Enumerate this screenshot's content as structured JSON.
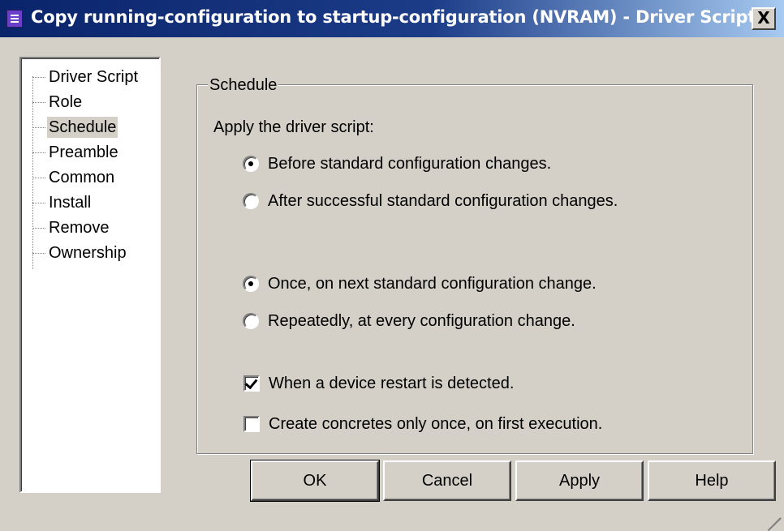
{
  "window": {
    "title": "Copy running-configuration to startup-configuration (NVRAM) - Driver Script",
    "close_label": "X"
  },
  "tree": {
    "items": [
      {
        "label": "Driver Script",
        "selected": false
      },
      {
        "label": "Role",
        "selected": false
      },
      {
        "label": "Schedule",
        "selected": true
      },
      {
        "label": "Preamble",
        "selected": false
      },
      {
        "label": "Common",
        "selected": false
      },
      {
        "label": "Install",
        "selected": false
      },
      {
        "label": "Remove",
        "selected": false
      },
      {
        "label": "Ownership",
        "selected": false
      }
    ]
  },
  "schedule": {
    "group_label": "Schedule",
    "apply_label": "Apply the driver script:",
    "timing_options": [
      {
        "label": "Before standard configuration changes.",
        "checked": true
      },
      {
        "label": "After successful standard configuration changes.",
        "checked": false
      }
    ],
    "frequency_options": [
      {
        "label": "Once, on next standard configuration change.",
        "checked": true
      },
      {
        "label": "Repeatedly, at every configuration change.",
        "checked": false
      }
    ],
    "checkboxes": [
      {
        "label": "When a device restart is detected.",
        "checked": true
      },
      {
        "label": "Create concretes only once, on first execution.",
        "checked": false
      }
    ]
  },
  "buttons": {
    "ok": "OK",
    "cancel": "Cancel",
    "apply": "Apply",
    "help": "Help"
  },
  "icons": {
    "app": "script-icon",
    "close": "close-icon",
    "resize": "resize-grip-icon"
  }
}
